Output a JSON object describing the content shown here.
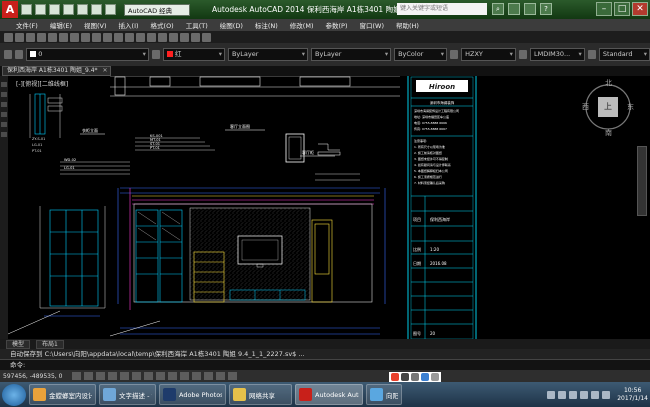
{
  "titlebar": {
    "app_logo": "A",
    "workspace": "AutoCAD 经典",
    "title": "Autodesk AutoCAD 2014    保利西海岸 A1栋3401 陶姐_9.4.dwg",
    "search_placeholder": "键入关键字或短语",
    "window_controls": [
      "–",
      "□",
      "✕"
    ]
  },
  "menubar": {
    "items": [
      "文件(F)",
      "编辑(E)",
      "视图(V)",
      "插入(I)",
      "格式(O)",
      "工具(T)",
      "绘图(D)",
      "标注(N)",
      "修改(M)",
      "参数(P)",
      "窗口(W)",
      "帮助(H)"
    ]
  },
  "properties_bar": {
    "layer": "0",
    "color": "红",
    "linetype": "ByLayer",
    "lineweight": "ByLayer",
    "plot_style": "ByColor",
    "text_style": "HZXY",
    "dim_style": "LMDIM30...",
    "table_style": "Standard",
    "color_hex": "#ff2020"
  },
  "file_tab": {
    "label": "保利西海岸 A1栋3401 陶姐_9.4*",
    "close": "✕"
  },
  "drawing": {
    "viewport_label": "[-][俯视][二维线框]",
    "viewcube": {
      "face": "上",
      "north": "北",
      "south": "南",
      "east": "东",
      "west": "西"
    },
    "title_block": {
      "brand": "Hiroon",
      "company_line": "深圳市海澜装饰",
      "rows": [
        {
          "label": "项目",
          "value": "保利西海岸"
        },
        {
          "label": "比例",
          "value": "1:20"
        },
        {
          "label": "日期",
          "value": "2016.08"
        },
        {
          "label": "图号",
          "value": "20"
        }
      ]
    },
    "elevation_title": "客厅立面图",
    "callouts": [
      "KS-001",
      "MT-01",
      "ST-01",
      "PT-01",
      "WD-02",
      "LG-01"
    ]
  },
  "layout_tabs": [
    "模型",
    "布局1"
  ],
  "command": {
    "history": "自动保存到 C:\\Users\\向阳\\appdata\\local\\temp\\保利西海岸 A1栋3401 陶姐  9.4_1_1_2227.sv$ ...",
    "prompt": "命令:"
  },
  "statusbar": {
    "coords": "597456, -489535, 0"
  },
  "taskbar": {
    "tasks": [
      {
        "label": "金螳螂室内设计C...",
        "icon_color": "#e9a23b",
        "active": false
      },
      {
        "label": "文字描述 - 记事本",
        "icon_color": "#6fa7d8",
        "active": false
      },
      {
        "label": "Adobe Photosh...",
        "icon_color": "#1e3b6b",
        "active": false
      },
      {
        "label": "网络共享",
        "icon_color": "#e6c14a",
        "active": false
      },
      {
        "label": "Autodesk AutoC...",
        "icon_color": "#c8201a",
        "active": true
      },
      {
        "label": "向阳",
        "icon_color": "#5aa7e0",
        "active": false
      }
    ],
    "clock_time": "10:56",
    "clock_date": "2017/1/14"
  }
}
